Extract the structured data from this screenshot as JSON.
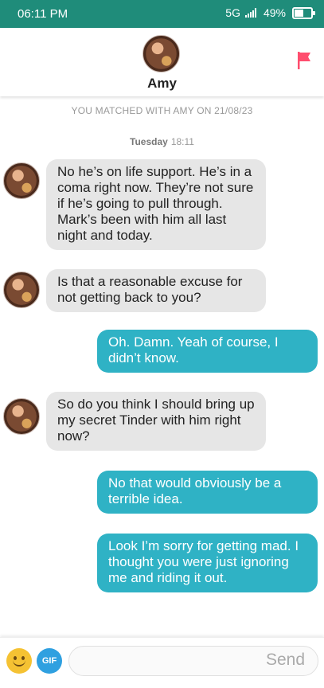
{
  "status_bar": {
    "time": "06:11 PM",
    "network": "5G",
    "battery": "49%"
  },
  "header": {
    "name": "Amy",
    "flag_icon": "flag-icon",
    "flag_color": "#ff4e6e"
  },
  "matched_text": "YOU MATCHED WITH AMY ON 21/08/23",
  "day_stamp": {
    "day": "Tuesday",
    "time": "18:11"
  },
  "messages": [
    {
      "from": "them",
      "text": "No he’s on life support. He’s in a coma right now. They’re not sure if he’s going to pull through. Mark’s been with him all last night and today."
    },
    {
      "from": "them",
      "text": "Is that a reasonable excuse for not getting back to you?"
    },
    {
      "from": "me",
      "text": "Oh. Damn. Yeah of course, I didn’t know."
    },
    {
      "from": "them",
      "text": "So do you think I should bring up my secret Tinder with him right now?"
    },
    {
      "from": "me",
      "text": "No that would obviously be a terrible idea."
    },
    {
      "from": "me",
      "text": "Look I’m sorry for getting mad. I thought you were just ignoring me and riding it out."
    }
  ],
  "composer": {
    "emoji_icon": "emoji-icon",
    "gif_label": "GIF",
    "send_label": "Send"
  },
  "colors": {
    "status_bar": "#1f8c7a",
    "outgoing_bubble": "#2fb2c5",
    "incoming_bubble": "#e6e6e6"
  }
}
